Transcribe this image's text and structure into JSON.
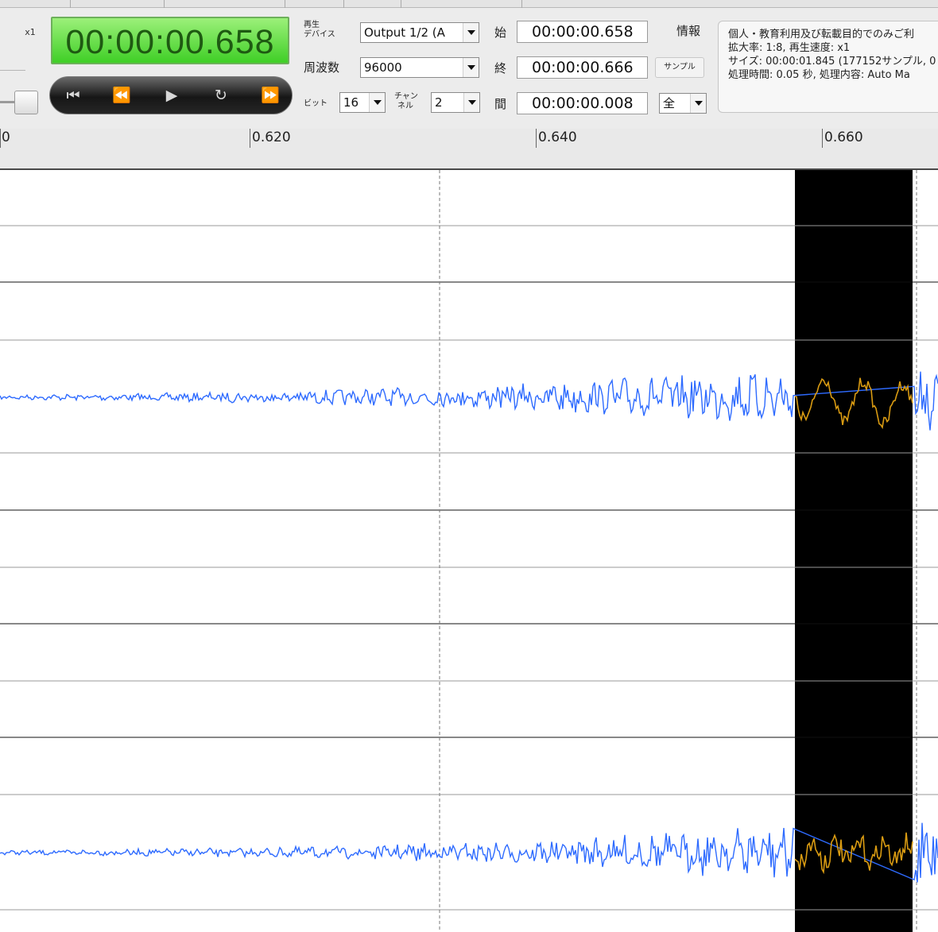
{
  "toolbar": {
    "speed_badge": "x1",
    "timecode": "00:00:00.658",
    "transport": {
      "to_start_icon": "⏮",
      "rewind_icon": "⏪",
      "play_icon": "▶",
      "loop_icon": "↻",
      "forward_icon": "⏩"
    },
    "device_label_line1": "再生",
    "device_label_line2": "デバイス",
    "device_value": "Output 1/2 (A",
    "freq_label": "周波数",
    "freq_value": "96000",
    "bit_label": "ビット",
    "bit_value": "16",
    "channel_label_line1": "チャン",
    "channel_label_line2": "ネル",
    "channel_value": "2",
    "start_label": "始",
    "start_value": "00:00:00.658",
    "end_label": "終",
    "end_value": "00:00:00.666",
    "range_label": "間",
    "range_value": "00:00:00.008",
    "info_label": "情報",
    "sample_button": "サンプル",
    "range_mode": "全"
  },
  "info": {
    "line1": "個人・教育利用及び転載目的でのみご利",
    "line2": "拡大率: 1:8, 再生速度: x1",
    "line3": "サイズ: 00:00:01.845 (177152サンプル, 0",
    "line4": "処理時間: 0.05 秒, 処理内容: Auto Ma"
  },
  "ruler": {
    "labels": [
      "0",
      "0.620",
      "0.640",
      "0.660"
    ]
  },
  "waveform": {
    "time_unit": "seconds",
    "selection_start": 0.658,
    "selection_end": 0.666,
    "colors": {
      "wave": "#2e6bff",
      "selected_wave": "#d99b12",
      "selection_bg": "#000000"
    }
  }
}
